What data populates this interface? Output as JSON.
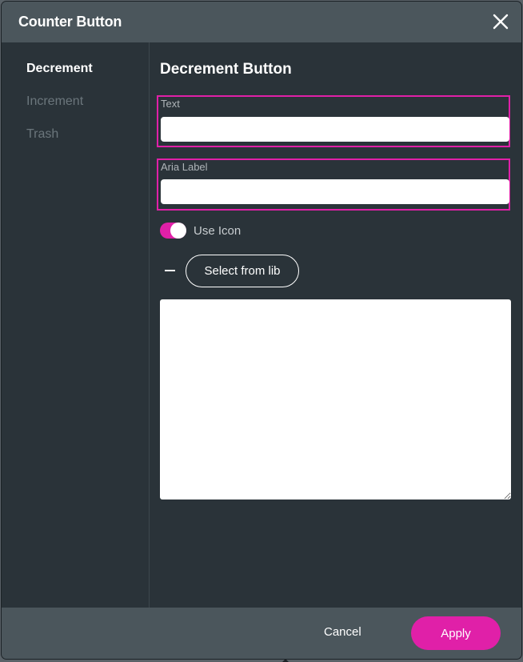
{
  "dialog": {
    "title": "Counter Button"
  },
  "sidebar": {
    "items": [
      {
        "label": "Decrement",
        "active": true
      },
      {
        "label": "Increment",
        "active": false
      },
      {
        "label": "Trash",
        "active": false
      }
    ]
  },
  "panel": {
    "title": "Decrement Button",
    "text_field": {
      "label": "Text",
      "value": ""
    },
    "aria_field": {
      "label": "Aria Label",
      "value": ""
    },
    "use_icon": {
      "label": "Use Icon",
      "checked": true
    },
    "icon_preview": "minus-icon",
    "select_from_lib_label": "Select from lib",
    "icon_code": ""
  },
  "footer": {
    "cancel_label": "Cancel",
    "apply_label": "Apply"
  },
  "colors": {
    "accent": "#e020a8",
    "header_bg": "#4b565c",
    "body_bg": "#2a3339"
  },
  "icons": {
    "close": "close-icon"
  }
}
